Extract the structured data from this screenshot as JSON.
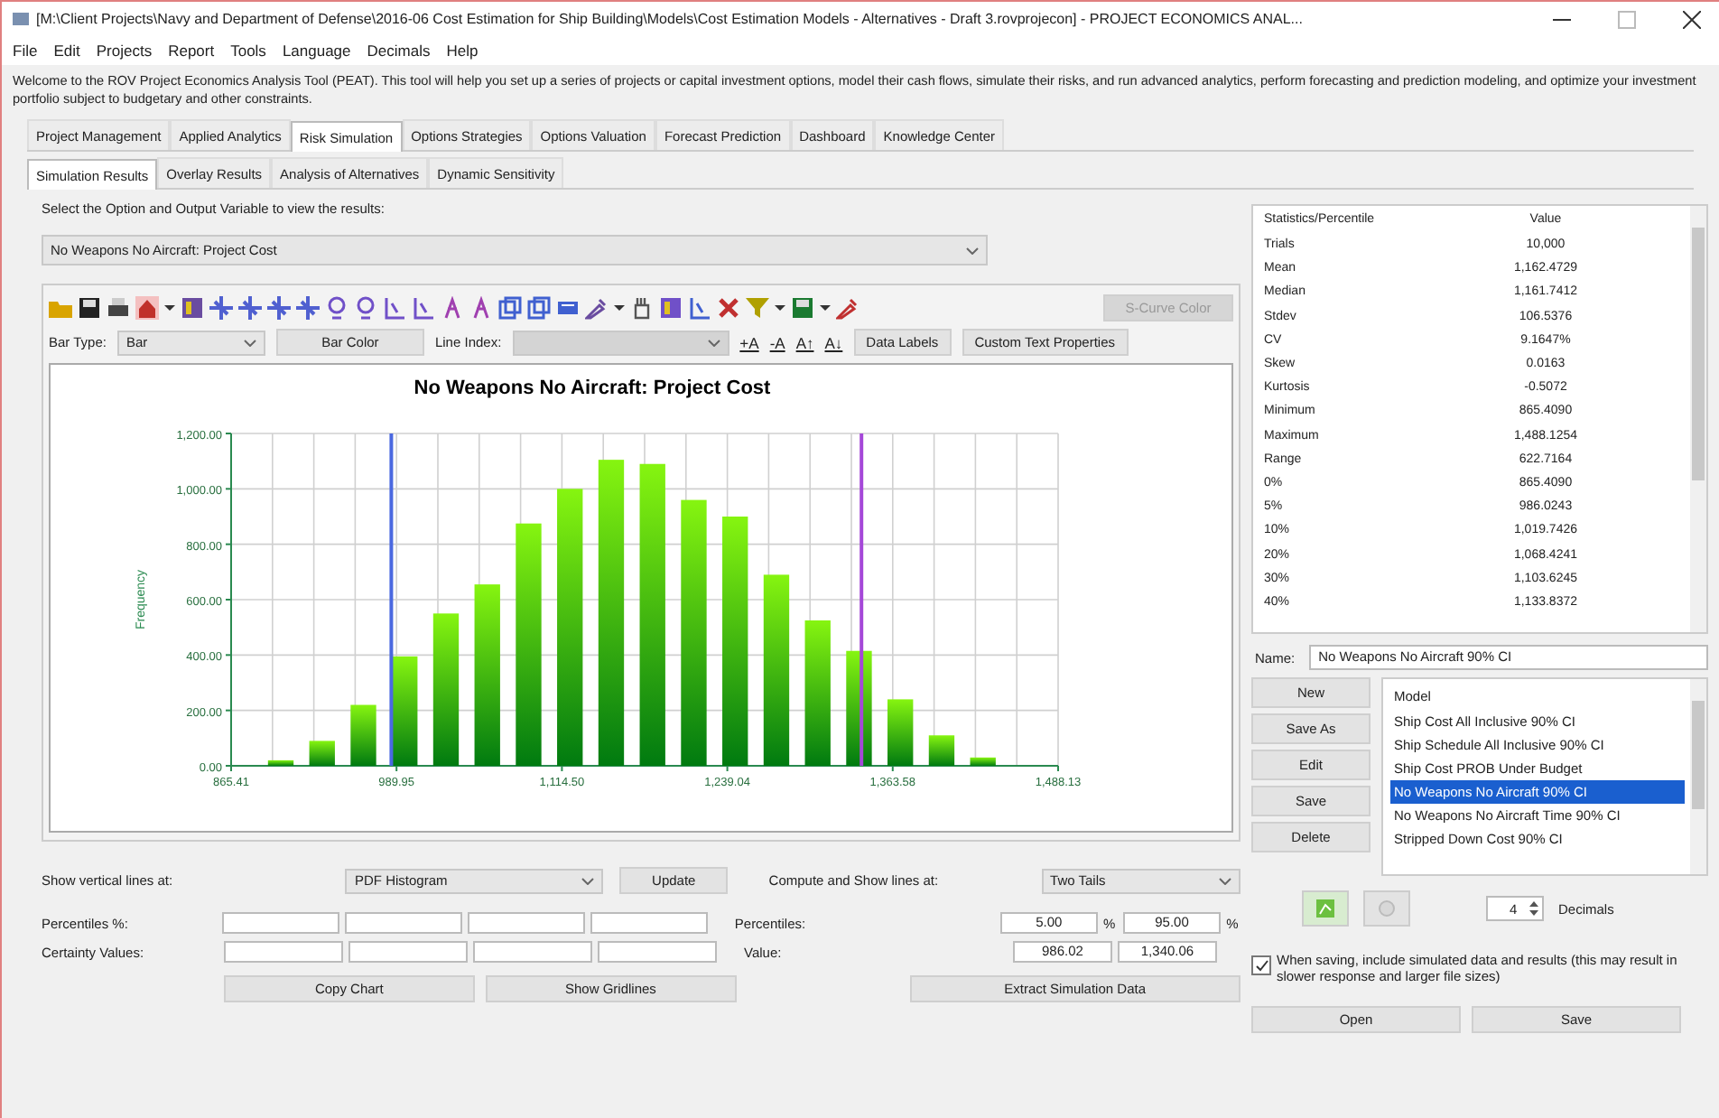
{
  "window": {
    "title": "[M:\\Client Projects\\Navy and Department of Defense\\2016-06 Cost Estimation for Ship Building\\Models\\Cost Estimation Models - Alternatives - Draft 3.rovprojecon] - PROJECT ECONOMICS ANAL..."
  },
  "menu": [
    "File",
    "Edit",
    "Projects",
    "Report",
    "Tools",
    "Language",
    "Decimals",
    "Help"
  ],
  "welcome": "Welcome to the ROV Project Economics Analysis Tool (PEAT). This tool will help you set up a series of projects or capital investment options, model their cash flows, simulate their risks, and run advanced analytics, perform forecasting and prediction modeling, and optimize your investment portfolio subject to budgetary and other constraints.",
  "tabs": [
    {
      "label": "Project Management",
      "selected": false
    },
    {
      "label": "Applied Analytics",
      "selected": false
    },
    {
      "label": "Risk Simulation",
      "selected": true
    },
    {
      "label": "Options Strategies",
      "selected": false
    },
    {
      "label": "Options Valuation",
      "selected": false
    },
    {
      "label": "Forecast Prediction",
      "selected": false
    },
    {
      "label": "Dashboard",
      "selected": false
    },
    {
      "label": "Knowledge Center",
      "selected": false
    }
  ],
  "subtabs": [
    {
      "label": "Simulation Results",
      "selected": true
    },
    {
      "label": "Overlay Results",
      "selected": false
    },
    {
      "label": "Analysis of Alternatives",
      "selected": false
    },
    {
      "label": "Dynamic Sensitivity",
      "selected": false
    }
  ],
  "select_label": "Select the Option and Output Variable to view the results:",
  "output_select": {
    "value": "No Weapons No Aircraft: Project Cost"
  },
  "chart_toolbar": {
    "scurve_button": {
      "label": "S-Curve Color",
      "disabled": true
    },
    "bar_type_label": "Bar Type:",
    "bar_type": "Bar",
    "bar_color_button": "Bar Color",
    "line_index_label": "Line Index:",
    "line_index_disabled": true,
    "font_buttons": [
      "+A",
      "-A",
      "A↑",
      "A↓"
    ],
    "data_labels_button": "Data Labels",
    "custom_text_button": "Custom Text Properties"
  },
  "chart": {
    "chart_data": {
      "type": "bar",
      "title": "No Weapons No Aircraft: Project Cost",
      "ylabel": "Frequency",
      "x": [
        902.8,
        933.9,
        965.0,
        996.1,
        1027.2,
        1058.3,
        1089.4,
        1120.5,
        1151.6,
        1182.7,
        1213.8,
        1244.9,
        1276.0,
        1307.1,
        1338.2,
        1369.3,
        1400.4,
        1431.5
      ],
      "values": [
        20,
        90,
        220,
        395,
        550,
        655,
        875,
        1000,
        1105,
        1090,
        960,
        900,
        690,
        525,
        415,
        240,
        110,
        30
      ],
      "xlim": [
        865.41,
        1488.13
      ],
      "ylim": [
        0,
        1200
      ],
      "xticks": [
        {
          "value": 865.41,
          "label": "865.41"
        },
        {
          "value": 989.95,
          "label": "989.95"
        },
        {
          "value": 1114.5,
          "label": "1,114.50"
        },
        {
          "value": 1239.04,
          "label": "1,239.04"
        },
        {
          "value": 1363.58,
          "label": "1,363.58"
        },
        {
          "value": 1488.13,
          "label": "1,488.13"
        }
      ],
      "yticks": [
        {
          "value": 0,
          "label": "0.00"
        },
        {
          "value": 200,
          "label": "200.00"
        },
        {
          "value": 400,
          "label": "400.00"
        },
        {
          "value": 600,
          "label": "600.00"
        },
        {
          "value": 800,
          "label": "800.00"
        },
        {
          "value": 1000,
          "label": "1,000.00"
        },
        {
          "value": 1200,
          "label": "1,200.00"
        }
      ],
      "grid": true,
      "ref_lines": [
        {
          "axis": "x",
          "value": 986.02,
          "color": "#4a68e0"
        },
        {
          "axis": "x",
          "value": 1340.06,
          "color": "#a548d8"
        }
      ]
    }
  },
  "vertical_lines": {
    "label": "Show vertical lines at:",
    "value": "PDF Histogram",
    "button": "Update"
  },
  "compute_lines": {
    "label": "Compute and Show lines at:",
    "value": "Two Tails"
  },
  "percentiles_row": {
    "label": "Percentiles %:"
  },
  "certainty_row": {
    "label": "Certainty Values:"
  },
  "percentiles": {
    "label": "Percentiles:",
    "items": [
      {
        "value": "5.00",
        "unit": "%"
      },
      {
        "value": "95.00",
        "unit": "%"
      }
    ]
  },
  "value": {
    "label": "Value:",
    "values": [
      "986.02",
      "1,340.06"
    ]
  },
  "bottom_buttons": [
    "Copy Chart",
    "Show Gridlines",
    "Extract Simulation Data"
  ],
  "statistics": {
    "columns": [
      "Statistics/Percentile",
      "Value"
    ],
    "rows": [
      [
        "Trials",
        "10,000"
      ],
      [
        "Mean",
        "1,162.4729"
      ],
      [
        "Median",
        "1,161.7412"
      ],
      [
        "Stdev",
        "106.5376"
      ],
      [
        "CV",
        "9.1647%"
      ],
      [
        "Skew",
        "0.0163"
      ],
      [
        "Kurtosis",
        "-0.5072"
      ],
      [
        "Minimum",
        "865.4090"
      ],
      [
        "Maximum",
        "1,488.1254"
      ],
      [
        "Range",
        "622.7164"
      ],
      [
        "0%",
        "865.4090"
      ],
      [
        "5%",
        "986.0243"
      ],
      [
        "10%",
        "1,019.7426"
      ],
      [
        "20%",
        "1,068.4241"
      ],
      [
        "30%",
        "1,103.6245"
      ],
      [
        "40%",
        "1,133.8372"
      ]
    ]
  },
  "name_field": {
    "label": "Name:",
    "value": "No Weapons No Aircraft 90% CI"
  },
  "model_buttons": [
    "New",
    "Save As",
    "Edit",
    "Save",
    "Delete"
  ],
  "models": {
    "header": "Model",
    "items": [
      {
        "label": "Ship Cost All Inclusive 90% CI",
        "selected": false
      },
      {
        "label": "Ship Schedule All Inclusive 90% CI",
        "selected": false
      },
      {
        "label": "Ship Cost PROB Under Budget",
        "selected": false
      },
      {
        "label": "No Weapons No Aircraft 90% CI",
        "selected": true
      },
      {
        "label": "No Weapons No Aircraft Time 90% CI",
        "selected": false
      },
      {
        "label": "Stripped Down Cost 90% CI",
        "selected": false
      }
    ]
  },
  "decimals": {
    "value": "4",
    "label": "Decimals"
  },
  "include_data": {
    "label": "When saving, include simulated data and results (this may result in slower response and larger file sizes)",
    "checked": true
  },
  "file_buttons": [
    "Open",
    "Save"
  ]
}
